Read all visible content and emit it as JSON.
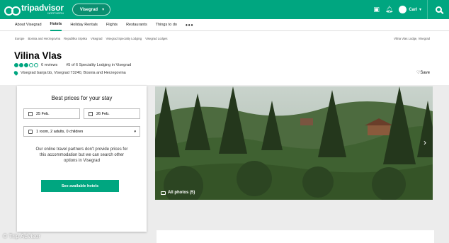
{
  "topbar": {
    "logo_text": "tripadvisor",
    "logo_sub": "NORTHERN",
    "location": "Visegrad",
    "user": "Carl"
  },
  "nav": [
    {
      "label": "About Visegrad"
    },
    {
      "label": "Hotels"
    },
    {
      "label": "Holiday Rentals"
    },
    {
      "label": "Flights"
    },
    {
      "label": "Restaurants"
    },
    {
      "label": "Things to do"
    },
    {
      "label": "•••"
    }
  ],
  "breadcrumbs": [
    "Europe",
    "Bosnia and Herzegovina",
    "Republika Srpska",
    "Visegrad",
    "Visegrad Specialty Lodging",
    "Visegrad Lodges"
  ],
  "breadcrumb_right": "Vilina Vlas Lodge, Visegrad",
  "hotel": {
    "name": "Vilina Vlas",
    "rating_bubbles": 3,
    "reviews": "6 reviews",
    "rank": "#5 of 6 Speciality Lodging in Visegrad",
    "address": "Visegrad banja bb, Visegrad 73240, Bosnia and Herzegovina",
    "save_label": "Save"
  },
  "booking": {
    "title": "Best prices for your stay",
    "checkin": "25 Feb.",
    "checkout": "26 Feb.",
    "guests": "1 room, 2 adults, 0 children",
    "message": "Our online travel partners don't provide prices for this accommodation but we can search other options in Visegrad",
    "cta": "See available hotels"
  },
  "photo": {
    "label": "All photos (5)"
  },
  "watermark": "© Trip Advisor",
  "colors": {
    "brand": "#00a680"
  }
}
